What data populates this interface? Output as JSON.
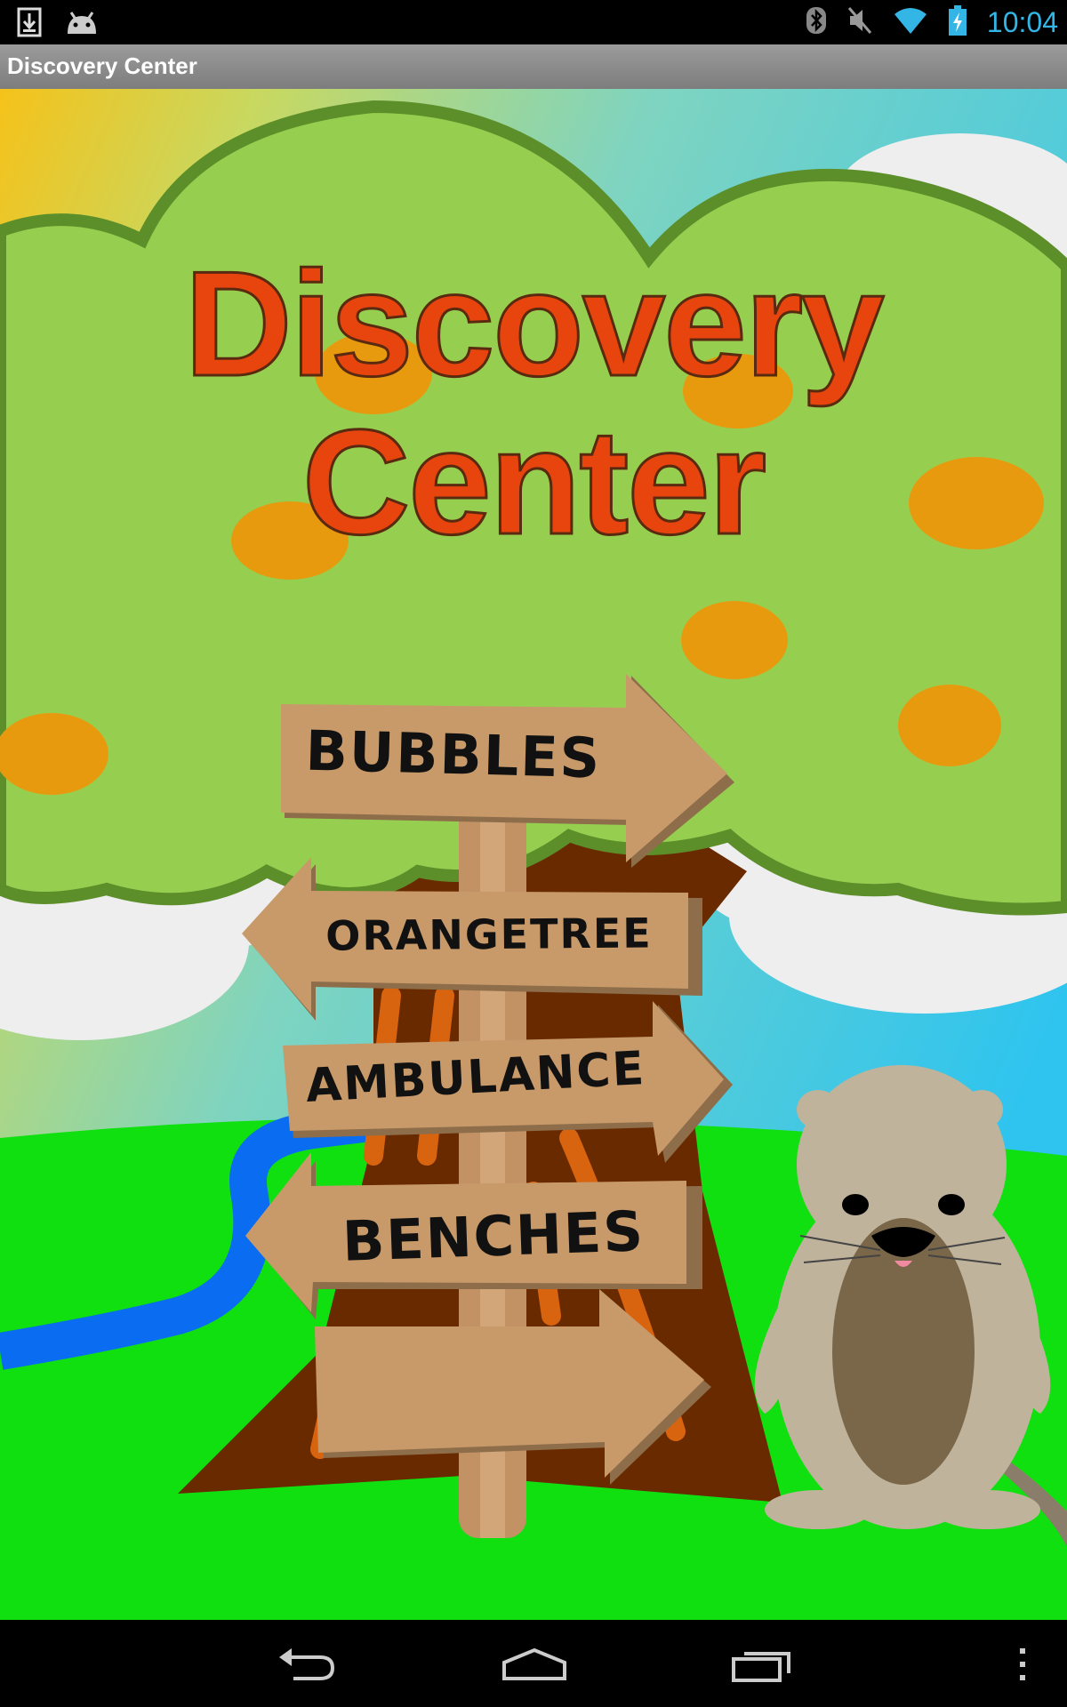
{
  "status_bar": {
    "time": "10:04",
    "icons": [
      "download-icon",
      "android-icon",
      "bluetooth-icon",
      "mute-icon",
      "wifi-icon",
      "battery-charging-icon"
    ]
  },
  "title_bar": {
    "title": "Discovery Center"
  },
  "main": {
    "title_line1": "Discovery",
    "title_line2": "Center",
    "signs": [
      {
        "label": "BUBBLES",
        "direction": "right"
      },
      {
        "label": "ORANGETREE",
        "direction": "left"
      },
      {
        "label": "AMBULANCE",
        "direction": "right"
      },
      {
        "label": "BENCHES",
        "direction": "left"
      },
      {
        "label": "",
        "direction": "right"
      }
    ]
  },
  "nav_bar": {
    "buttons": [
      "back-icon",
      "home-icon",
      "recent-apps-icon",
      "overflow-menu-icon"
    ]
  },
  "colors": {
    "title_red": "#e8450e",
    "tree_green": "#96cf50",
    "tree_outline": "#5c8f2a",
    "orange_fruit": "#e89a0e",
    "grass": "#10e010",
    "river": "#0a6cf0",
    "trunk": "#6a2a00",
    "sign_wood": "#c89a6a",
    "sky": "#33c6ee",
    "clock_blue": "#33b5e5"
  }
}
